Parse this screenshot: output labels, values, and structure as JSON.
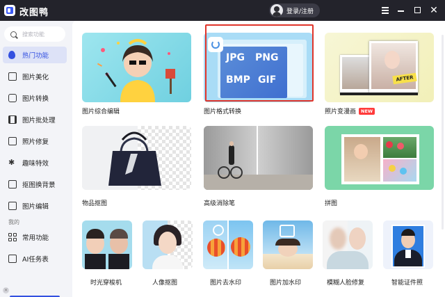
{
  "app": {
    "title": "改图鸭",
    "login_label": "登录/注册"
  },
  "search": {
    "placeholder": "搜索功能"
  },
  "sidebar": {
    "items": [
      {
        "label": "热门功能",
        "icon": "flame-icon",
        "active": true
      },
      {
        "label": "图片美化",
        "icon": "image-beautify-icon"
      },
      {
        "label": "图片转换",
        "icon": "convert-icon"
      },
      {
        "label": "图片批处理",
        "icon": "batch-icon"
      },
      {
        "label": "照片修复",
        "icon": "repair-icon"
      },
      {
        "label": "趣味特效",
        "icon": "sparkle-icon"
      },
      {
        "label": "抠图换背景",
        "icon": "cutout-icon"
      },
      {
        "label": "图片编辑",
        "icon": "edit-icon"
      }
    ],
    "section_label": "我的",
    "my_items": [
      {
        "label": "常用功能",
        "icon": "grid-icon"
      },
      {
        "label": "AI任务表",
        "icon": "task-list-icon"
      }
    ]
  },
  "cards_large": [
    {
      "label": "图片综合编辑"
    },
    {
      "label": "图片格式转换",
      "formats": [
        "JPG",
        "PNG",
        "BMP",
        "GIF"
      ]
    },
    {
      "label": "照片变漫画",
      "badge": "NEW",
      "after_tag": "AFTER"
    },
    {
      "label": "物品抠图"
    },
    {
      "label": "高级消除笔"
    },
    {
      "label": "拼图"
    }
  ],
  "cards_small": [
    {
      "label": "时光穿梭机"
    },
    {
      "label": "人像抠图"
    },
    {
      "label": "图片去水印"
    },
    {
      "label": "图片加水印"
    },
    {
      "label": "模糊人脸修复"
    },
    {
      "label": "智能证件照"
    }
  ],
  "colors": {
    "accent": "#3350e0",
    "titlebar": "#23232b",
    "highlight": "#e0342a"
  }
}
